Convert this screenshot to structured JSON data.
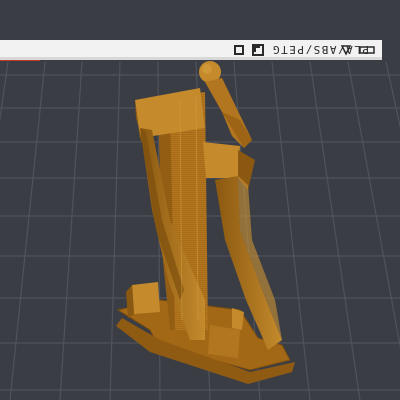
{
  "viewport": {
    "background": "#3b3d44",
    "grid_color": "#4e5159",
    "model_color": "#b5781f"
  },
  "bed": {
    "material_label": "PLA/ABS/PETG",
    "logo_icon": "printer-brand-logo-icon",
    "corner_icon": "square-corner-icon"
  },
  "model": {
    "name_icon": "sliced-model-preview"
  }
}
